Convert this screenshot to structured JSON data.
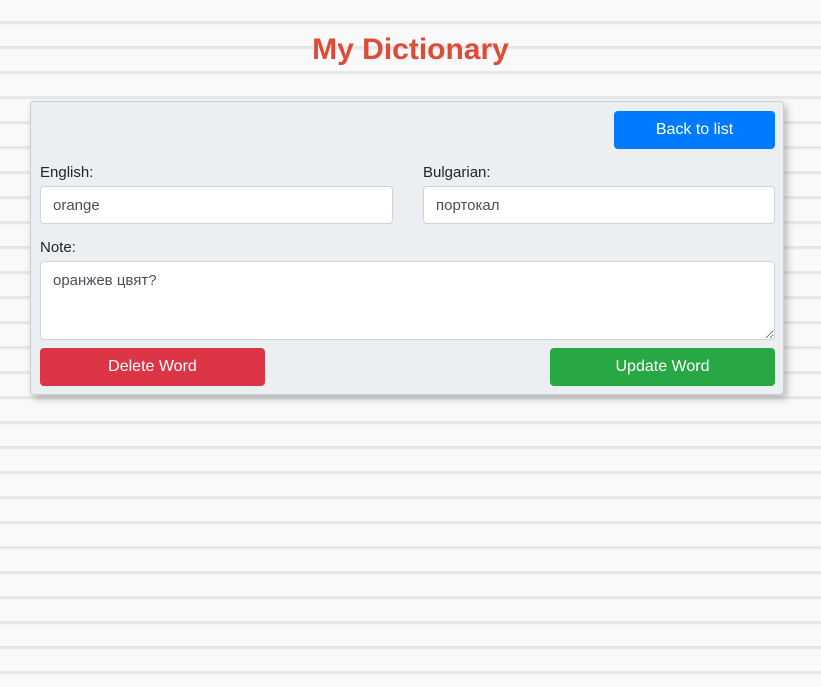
{
  "header": {
    "title": "My Dictionary"
  },
  "form": {
    "back_label": "Back to list",
    "english_label": "English:",
    "english_value": "orange",
    "bulgarian_label": "Bulgarian:",
    "bulgarian_value": "портокал",
    "note_label": "Note:",
    "note_value": "оранжев цвят?",
    "delete_label": "Delete Word",
    "update_label": "Update Word"
  },
  "colors": {
    "title": "#dd4b39",
    "primary": "#007bff",
    "danger": "#dc3545",
    "success": "#28a745",
    "card_background": "#eceff1"
  }
}
